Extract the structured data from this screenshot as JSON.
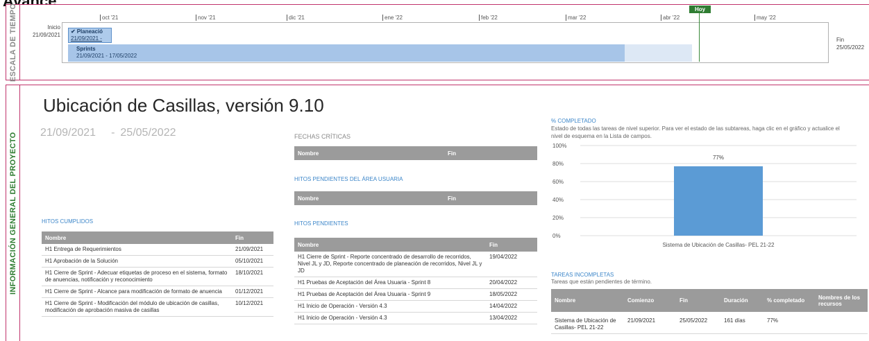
{
  "page_title": "Avance",
  "timeline": {
    "side_label": "ESCALA DE TIEMPO",
    "months": [
      "oct '21",
      "nov '21",
      "dic '21",
      "ene '22",
      "feb '22",
      "mar '22",
      "abr '22",
      "may '22"
    ],
    "start_label": "Inicio",
    "start_date": "21/09/2021",
    "end_label": "Fin",
    "end_date": "25/05/2022",
    "today_label": "Hoy",
    "planned": {
      "title": "Planeació",
      "dates": "21/09/2021 -"
    },
    "sprints": {
      "title": "Sprints",
      "dates": "21/09/2021 - 17/05/2022"
    }
  },
  "info": {
    "side_label": "INFORMACIÓN GENERAL DEL PROYECTO",
    "project_name": "Ubicación de Casillas, versión 9.10",
    "start_date": "21/09/2021",
    "separator": "-",
    "end_date": "25/05/2022"
  },
  "fechas_criticas": {
    "heading": "FECHAS CRÍTICAS",
    "columns": [
      "Nombre",
      "Fin"
    ]
  },
  "hitos_pendientes_usuaria": {
    "heading": "HITOS PENDIENTES DEL ÁREA USUARIA",
    "columns": [
      "Nombre",
      "Fin"
    ]
  },
  "hitos_cumplidos": {
    "heading": "HITOS CUMPLIDOS",
    "columns": [
      "Nombre",
      "Fin"
    ],
    "rows": [
      {
        "name": "H1 Entrega de Requerimientos",
        "end": "21/09/2021"
      },
      {
        "name": "H1 Aprobación de la Solución",
        "end": "05/10/2021"
      },
      {
        "name": "H1 Cierre de Sprint - Adecuar etiquetas de proceso en el sistema, formato de anuencias, notificación y reconocimiento",
        "end": "18/10/2021"
      },
      {
        "name": "H1 Cierre de Sprint - Alcance para modificación de formato de anuencia",
        "end": "01/12/2021"
      },
      {
        "name": "H1 Cierre de Sprint - Modificación del módulo de ubicación de casillas, modificación de aprobación masiva de casillas",
        "end": "10/12/2021"
      }
    ]
  },
  "hitos_pendientes": {
    "heading": "HITOS PENDIENTES",
    "columns": [
      "Nombre",
      "Fin"
    ],
    "rows": [
      {
        "name": "H1 Cierre de Sprint - Reporte concentrado de desarrollo de recorridos, Nivel JL y JD, Reporte concentrado de planeación de recorridos, Nivel JL y JD",
        "end": "19/04/2022"
      },
      {
        "name": "H1 Pruebas de Aceptación del Área Usuaria - Sprint 8",
        "end": "20/04/2022"
      },
      {
        "name": "H1 Pruebas de Aceptación del Área Usuaria - Sprint 9",
        "end": "18/05/2022"
      },
      {
        "name": "H1 Inicio de Operación - Versión 4.3",
        "end": "14/04/2022"
      },
      {
        "name": "H1 Inicio de Operación - Versión 4.3",
        "end": "13/04/2022"
      }
    ]
  },
  "completion": {
    "heading": "% COMPLETADO",
    "description": "Estado de todas las tareas de nivel superior. Para ver el estado de las subtareas, haga clic en el gráfico y actualice el nivel de esquema en la Lista de campos."
  },
  "chart_data": {
    "type": "bar",
    "categories": [
      "Sistema de Ubicación de Casillas- PEL 21-22"
    ],
    "values": [
      77
    ],
    "value_labels": [
      "77%"
    ],
    "y_ticks": [
      "0%",
      "20%",
      "40%",
      "60%",
      "80%",
      "100%"
    ],
    "ylim": [
      0,
      100
    ],
    "bar_color": "#5b9bd5",
    "grid": true
  },
  "tareas_incompletas": {
    "heading": "TAREAS INCOMPLETAS",
    "description": "Tareas que están pendientes de término.",
    "columns": [
      "Nombre",
      "Comienzo",
      "Fin",
      "Duración",
      "% completado",
      "Nombres de los recursos"
    ],
    "rows": [
      {
        "name": "Sistema de Ubicación de Casillas- PEL 21-22",
        "start": "21/09/2021",
        "end": "25/05/2022",
        "duration": "161 días",
        "pct": "77%",
        "resources": ""
      }
    ]
  },
  "colors": {
    "accent_border": "#c0336b",
    "heading_blue": "#3c86c9",
    "today_green": "#2f7d32",
    "bar_blue": "#a7c5e8"
  }
}
